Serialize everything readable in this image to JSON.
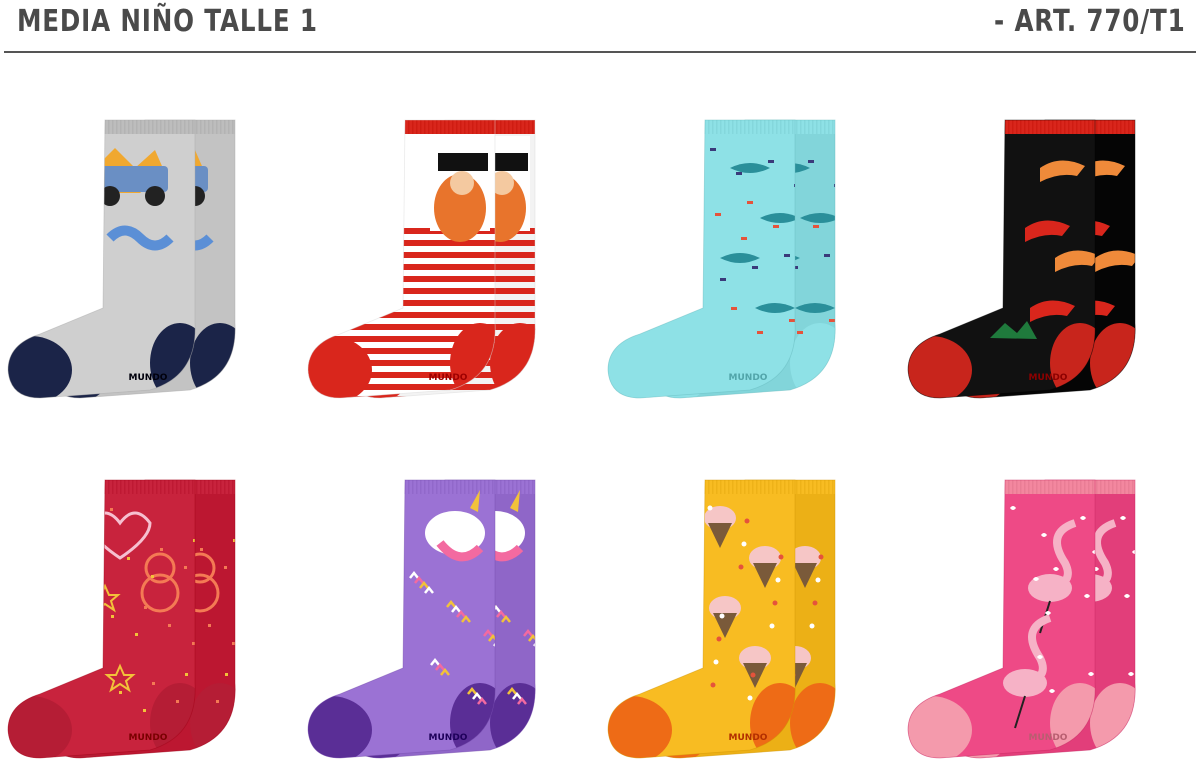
{
  "header": {
    "title": "MEDIA NIÑO TALLE 1",
    "article": "- ART. 770/T1"
  },
  "products": [
    {
      "motif": "monster-truck",
      "brand": "MUNDO",
      "body": "#cfcfcf",
      "cuff": "#bdbdbd",
      "heel": "#1b2448",
      "accent": "#5b8fd6"
    },
    {
      "motif": "pirate",
      "brand": "MUNDO",
      "body": "#ffffff",
      "cuff": "#d9261c",
      "heel": "#d9261c",
      "accent": "#e8742c"
    },
    {
      "motif": "sharks",
      "brand": "MUNDO",
      "body": "#8ee1e6",
      "cuff": "#8ee1e6",
      "heel": "#8ee1e6",
      "accent": "#2a8f9a"
    },
    {
      "motif": "dinosaurs",
      "brand": "MUNDO",
      "body": "#111111",
      "cuff": "#d9261c",
      "heel": "#c8251c",
      "accent": "#ef8a3a"
    },
    {
      "motif": "teddy-bear-hearts",
      "brand": "MUNDO",
      "body": "#c8233d",
      "cuff": "#c8233d",
      "heel": "#b51d35",
      "accent": "#f2c23a"
    },
    {
      "motif": "unicorn",
      "brand": "MUNDO",
      "body": "#9b72d4",
      "cuff": "#9b72d4",
      "heel": "#5a2e96",
      "accent": "#f36aa0"
    },
    {
      "motif": "ice-cream",
      "brand": "MUNDO",
      "body": "#f8bc22",
      "cuff": "#f8bc22",
      "heel": "#ee6b16",
      "accent": "#f6c6c6"
    },
    {
      "motif": "flamingo",
      "brand": "MUNDO",
      "body": "#ee4a86",
      "cuff": "#f3879f",
      "heel": "#f49aac",
      "accent": "#f6b2c6"
    }
  ]
}
